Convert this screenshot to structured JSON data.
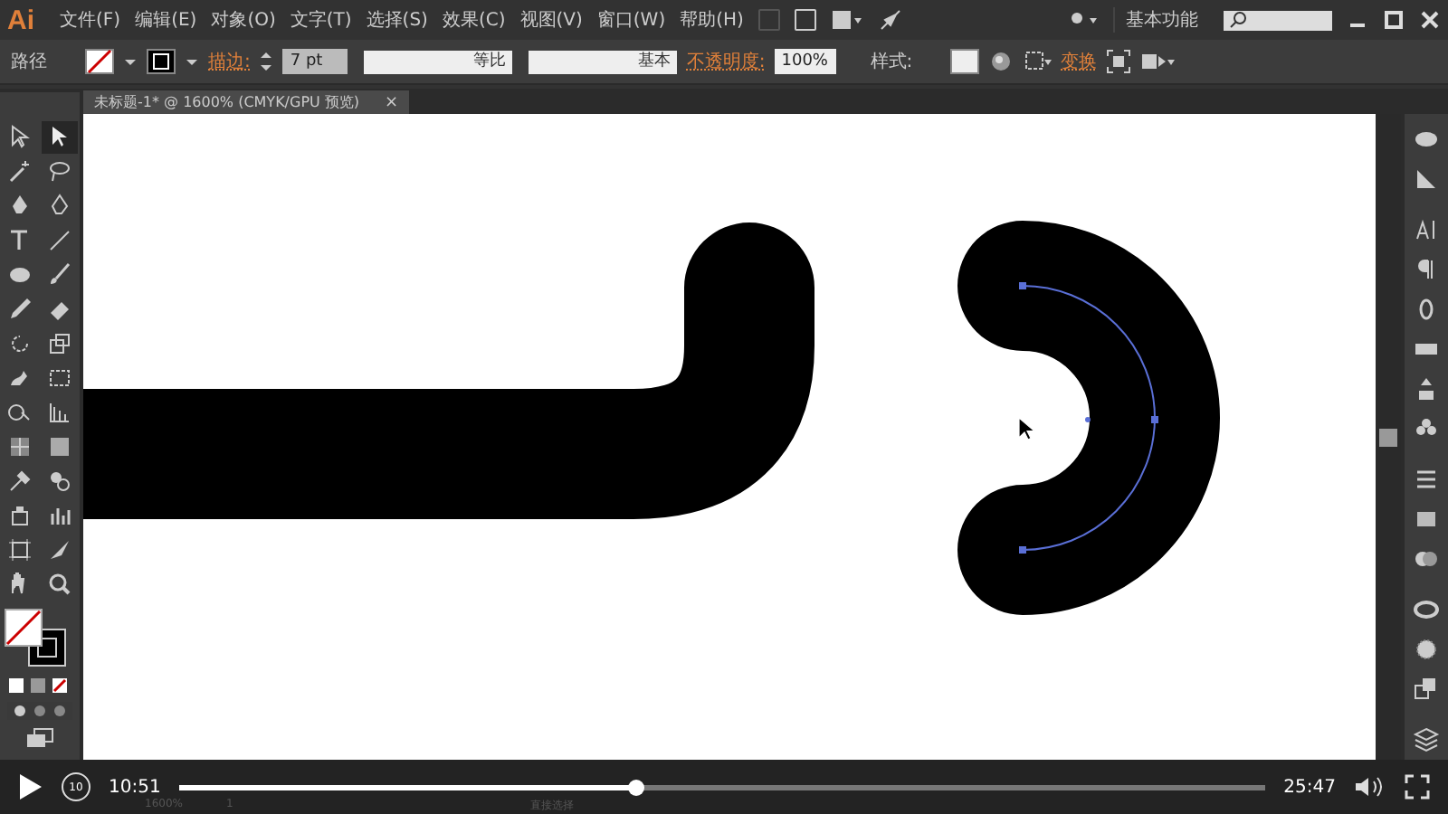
{
  "menu_bar": {
    "logo": "Ai",
    "items": [
      "文件(F)",
      "编辑(E)",
      "对象(O)",
      "文字(T)",
      "选择(S)",
      "效果(C)",
      "视图(V)",
      "窗口(W)",
      "帮助(H)"
    ],
    "workspace": "基本功能"
  },
  "control_bar": {
    "object_type": "路径",
    "stroke_label": "描边:",
    "stroke_weight": "7 pt",
    "profile": "等比",
    "brush": "基本",
    "opacity_label": "不透明度:",
    "opacity": "100%",
    "style_label": "样式:",
    "transform": "变换"
  },
  "document_tab": {
    "title": "未标题-1* @ 1600% (CMYK/GPU 预览)",
    "close": "×"
  },
  "status_bar": {
    "zoom": "1600%",
    "artboard": "1",
    "tool": "直接选择"
  },
  "player": {
    "replay_seconds": "10",
    "elapsed": "10:51",
    "duration": "25:47",
    "level": 0.42
  }
}
